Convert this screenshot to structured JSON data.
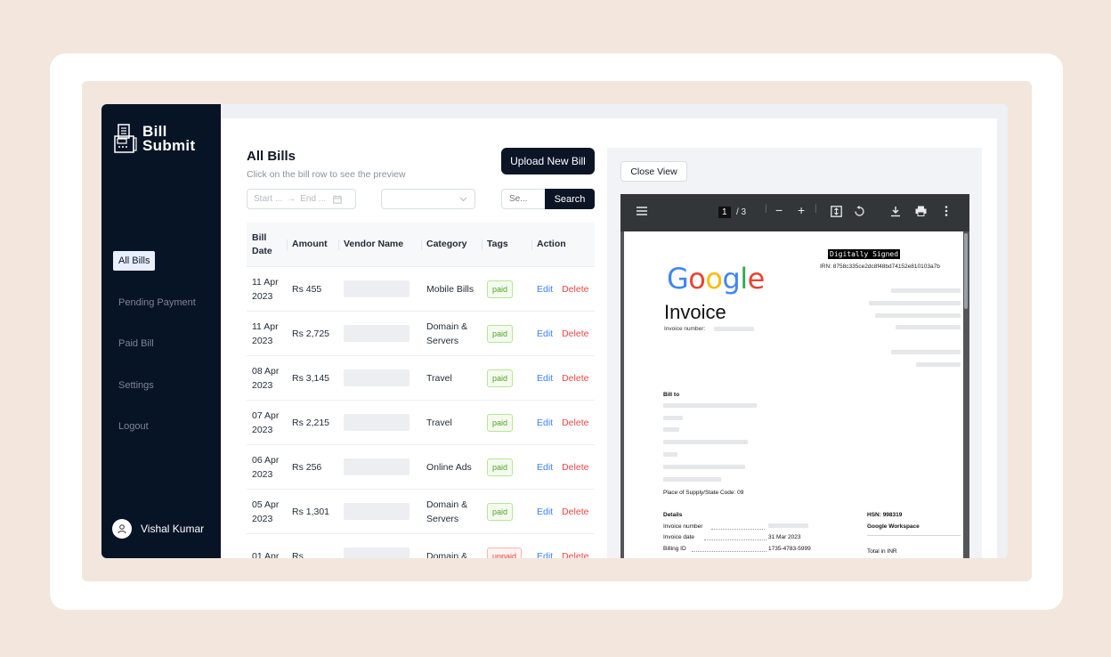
{
  "brand": {
    "line1": "Bill",
    "line2": "Submit"
  },
  "sidebar": {
    "items": [
      {
        "label": "All Bills",
        "active": true
      },
      {
        "label": "Pending Payment",
        "active": false
      },
      {
        "label": "Paid Bill",
        "active": false
      },
      {
        "label": "Settings",
        "active": false
      },
      {
        "label": "Logout",
        "active": false
      }
    ],
    "user": {
      "name": "Vishal Kumar"
    }
  },
  "main": {
    "title": "All Bills",
    "subtitle": "Click on the bill row to see the preview",
    "upload_label": "Upload New Bill",
    "filters": {
      "start_placeholder": "Start ...",
      "end_placeholder": "End ...",
      "search_placeholder": "Se...",
      "search_label": "Search"
    },
    "table": {
      "headers": [
        "Bill Date",
        "Amount",
        "Vendor Name",
        "Category",
        "Tags",
        "Action"
      ],
      "edit_label": "Edit",
      "delete_label": "Delete",
      "rows": [
        {
          "date": "11 Apr 2023",
          "amount": "Rs 455",
          "category": "Mobile Bills",
          "tag": "paid"
        },
        {
          "date": "11 Apr 2023",
          "amount": "Rs 2,725",
          "category": "Domain & Servers",
          "tag": "paid"
        },
        {
          "date": "08 Apr 2023",
          "amount": "Rs 3,145",
          "category": "Travel",
          "tag": "paid"
        },
        {
          "date": "07 Apr 2023",
          "amount": "Rs 2,215",
          "category": "Travel",
          "tag": "paid"
        },
        {
          "date": "06 Apr 2023",
          "amount": "Rs 256",
          "category": "Online Ads",
          "tag": "paid"
        },
        {
          "date": "05 Apr 2023",
          "amount": "Rs 1,301",
          "category": "Domain & Servers",
          "tag": "paid"
        },
        {
          "date": "01 Apr",
          "amount": "Rs",
          "category": "Domain &",
          "tag": "unpaid"
        }
      ]
    }
  },
  "preview": {
    "close_label": "Close View",
    "viewer": {
      "page_current": "1",
      "page_total": "/ 3"
    },
    "doc": {
      "signed": "Digitally Signed",
      "irn": "IRN: 8758c335ce2dc8f48bd74152e810103a7b",
      "logo": "Google",
      "title": "Invoice",
      "invoice_number_label": "Invoice number:",
      "bill_to": "Bill to",
      "place_of_supply": "Place of Supply/State Code: 09",
      "details": "Details",
      "invoice_number": "Invoice number",
      "invoice_date": "Invoice date",
      "invoice_date_value": "31 Mar 2023",
      "billing_id": "Billing ID",
      "billing_id_value": "1735-4783-5999",
      "hsn": "HSN: 998319",
      "workspace": "Google Workspace",
      "total": "Total in INR"
    }
  },
  "colors": {
    "sidebar_bg": "#071426",
    "primary_btn": "#0b1526",
    "paid_tag": "#52a32a",
    "unpaid_tag": "#e0443e",
    "edit_link": "#3b82f6",
    "delete_link": "#ef4444"
  }
}
